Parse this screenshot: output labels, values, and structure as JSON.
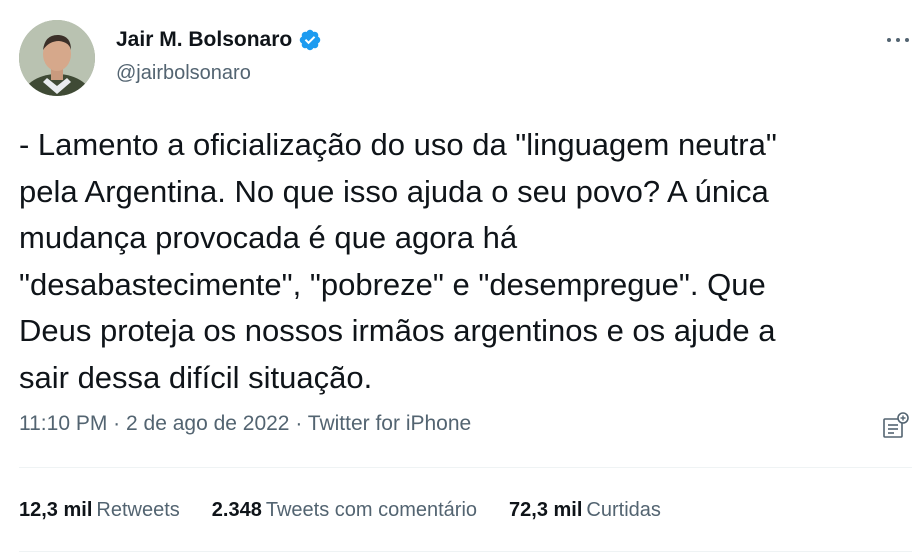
{
  "author": {
    "display_name": "Jair M. Bolsonaro",
    "handle": "@jairbolsonaro",
    "verified_icon": "verified-badge-icon",
    "avatar_icon": "profile-photo"
  },
  "tweet": {
    "text": "- Lamento a oficialização do uso da \"linguagem neutra\"\npela Argentina. No que isso ajuda o seu povo? A única\nmudança provocada é que agora há\n\"desabastecimente\", \"pobreze\" e \"desempregue\". Que\nDeus proteja os nossos irmãos argentinos e os ajude a\nsair dessa difícil situação."
  },
  "meta": {
    "time": "11:10 PM",
    "separator": " · ",
    "date": "2 de ago de 2022",
    "source": "Twitter for iPhone"
  },
  "stats": [
    {
      "count": "12,3 mil",
      "label": "Retweets"
    },
    {
      "count": "2.348",
      "label": "Tweets com comentário"
    },
    {
      "count": "72,3 mil",
      "label": "Curtidas"
    }
  ],
  "colors": {
    "text": "#0f1419",
    "secondary": "#536471",
    "verified": "#1d9bf0",
    "divider": "#eff3f4"
  }
}
